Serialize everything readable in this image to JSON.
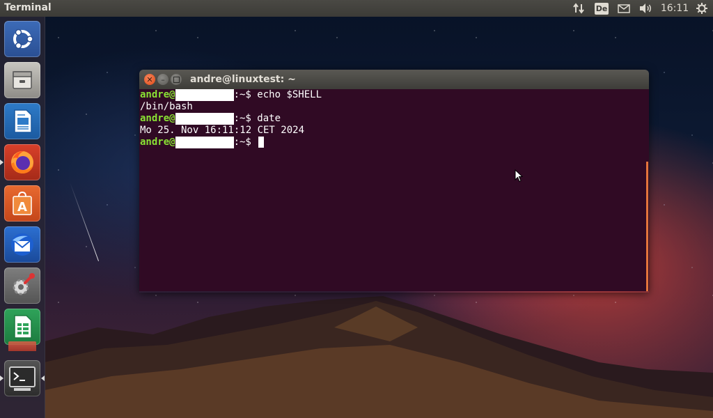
{
  "panel": {
    "app_title": "Terminal",
    "clock": "16:11",
    "keyboard_layout": "De"
  },
  "launcher": {
    "items": [
      {
        "name": "Ubuntu Dash",
        "icon": "ubuntu-logo-icon"
      },
      {
        "name": "Files",
        "icon": "file-cabinet-icon"
      },
      {
        "name": "LibreOffice Writer",
        "icon": "writer-document-icon"
      },
      {
        "name": "Firefox",
        "icon": "firefox-icon"
      },
      {
        "name": "Ubuntu Software",
        "icon": "software-bag-icon"
      },
      {
        "name": "Thunderbird",
        "icon": "thunderbird-icon"
      },
      {
        "name": "System Settings",
        "icon": "settings-gear-icon"
      },
      {
        "name": "LibreOffice Calc",
        "icon": "calc-spreadsheet-icon"
      },
      {
        "name": "Terminal",
        "icon": "terminal-icon"
      }
    ]
  },
  "terminal": {
    "window_title": "andre@linuxtest: ~",
    "prompt_user": "andre@",
    "prompt_suffix": ":~$ ",
    "lines": [
      {
        "type": "prompt",
        "command": "echo $SHELL"
      },
      {
        "type": "output",
        "text": "/bin/bash"
      },
      {
        "type": "prompt",
        "command": "date"
      },
      {
        "type": "output",
        "text": "Mo 25. Nov 16:11:12 CET 2024"
      },
      {
        "type": "prompt",
        "command": ""
      }
    ]
  },
  "colors": {
    "terminal_bg": "#300a24",
    "prompt_green": "#8ae234",
    "close_orange": "#de4a16",
    "panel_bg": "#3c3b37"
  }
}
